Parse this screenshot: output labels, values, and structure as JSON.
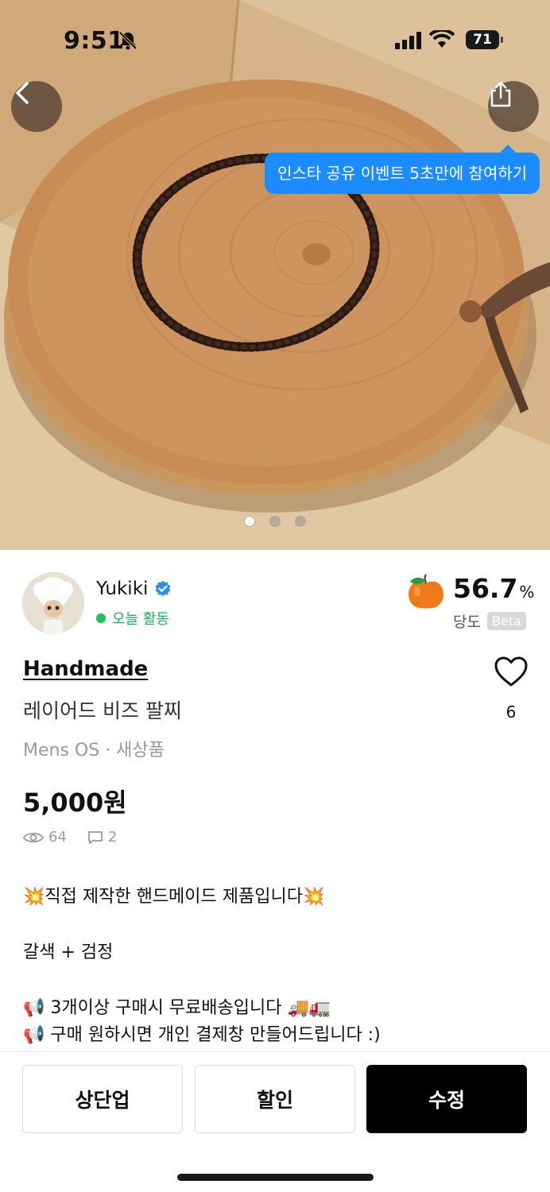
{
  "status_bar": {
    "time": "9:51",
    "battery": "71"
  },
  "gallery": {
    "tooltip": "인스타 공유 이벤트 5초만에 참여하기",
    "page_count": 3,
    "current_page": 1
  },
  "seller": {
    "name": "Yukiki",
    "activity": "오늘 활동",
    "ratio_value": "56.7",
    "ratio_unit": "%",
    "ratio_label": "당도",
    "ratio_badge": "Beta"
  },
  "product": {
    "brand": "Handmade",
    "title": "레이어드 비즈 팔찌",
    "category": "Mens OS · 새상품",
    "price": "5,000원",
    "views": "64",
    "chats": "2",
    "likes": "6"
  },
  "description": {
    "line1": "💥직접 제작한 핸드메이드 제품입니다💥",
    "line2": "갈색 + 검정",
    "line3": "📢 3개이상 구매시 무료배송입니다 🚚🚛",
    "line4": "📢 구매 원하시면 개인 결제창 만들어드립니다 :)"
  },
  "actions": {
    "bump": "상단업",
    "discount": "할인",
    "edit": "수정"
  },
  "colors": {
    "accent_blue": "#1a8cff",
    "active_green": "#20c05c",
    "primary_button": "#000000"
  }
}
